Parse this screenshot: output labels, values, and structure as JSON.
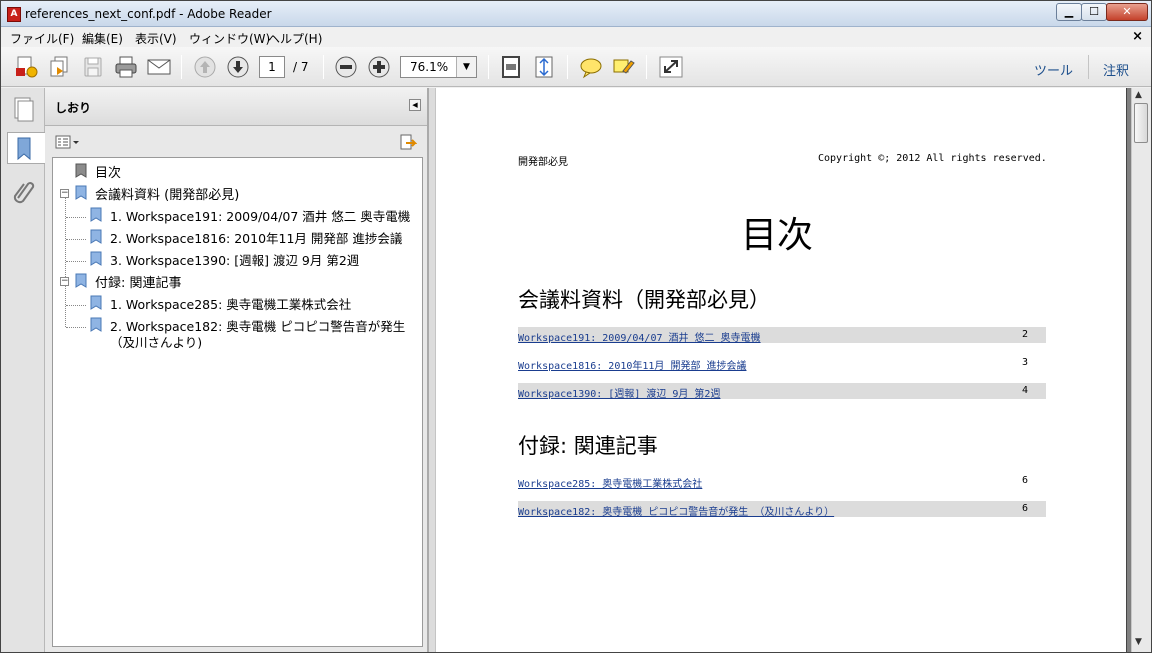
{
  "window": {
    "title": "references_next_conf.pdf - Adobe Reader",
    "app_icon_glyph": "A",
    "minimize": "▁",
    "maximize": "☐",
    "close": "✕"
  },
  "menu": {
    "items": [
      "ファイル(F)",
      "編集(E)",
      "表示(V)",
      "ウィンドウ(W)",
      "ヘルプ(H)"
    ],
    "close_doc": "×"
  },
  "toolbar": {
    "current_page": "1",
    "total_pages": "/ 7",
    "zoom": "76.1%",
    "tools_label": "ツール",
    "comment_label": "注釈",
    "icons": [
      "create-pdf-icon",
      "combine-icon",
      "save-icon",
      "print-icon",
      "email-icon",
      "page-up-icon",
      "page-down-icon",
      "zoom-out-icon",
      "zoom-in-icon",
      "fit-page-icon",
      "fit-width-icon",
      "sticky-note-icon",
      "highlight-icon",
      "full-screen-icon"
    ]
  },
  "bookmarks": {
    "title": "しおり",
    "items": [
      {
        "label": "目次",
        "level": 0
      },
      {
        "label": "会議料資料 (開発部必見)",
        "level": 0
      },
      {
        "label": "1. Workspace191: 2009/04/07 酒井 悠二 奥寺電機",
        "level": 1
      },
      {
        "label": "2. Workspace1816: 2010年11月 開発部 進捗会議",
        "level": 1
      },
      {
        "label": "3. Workspace1390: [週報] 渡辺 9月 第2週",
        "level": 1
      },
      {
        "label": "付録: 関連記事",
        "level": 0
      },
      {
        "label": "1. Workspace285: 奥寺電機工業株式会社",
        "level": 1
      },
      {
        "label": "2. Workspace182: 奥寺電機 ピコピコ警告音が発生",
        "level": 1,
        "continuation": "（及川さんより)"
      }
    ]
  },
  "document": {
    "header_left": "開発部必見",
    "header_right": "Copyright ©; 2012 All rights reserved.",
    "title": "目次",
    "sections": [
      {
        "title": "会議料資料（開発部必見）",
        "entries": [
          {
            "text": "Workspace191: 2009/04/07 酒井 悠二 奥寺電機",
            "page": "2"
          },
          {
            "text": "Workspace1816: 2010年11月 開発部 進捗会議",
            "page": "3"
          },
          {
            "text": "Workspace1390: [週報] 渡辺 9月 第2週",
            "page": "4"
          }
        ]
      },
      {
        "title": "付録: 関連記事",
        "entries": [
          {
            "text": "Workspace285: 奥寺電機工業株式会社",
            "page": "6"
          },
          {
            "text": "Workspace182: 奥寺電機 ピコピコ警告音が発生 （及川さんより）",
            "page": "6"
          }
        ]
      }
    ]
  }
}
